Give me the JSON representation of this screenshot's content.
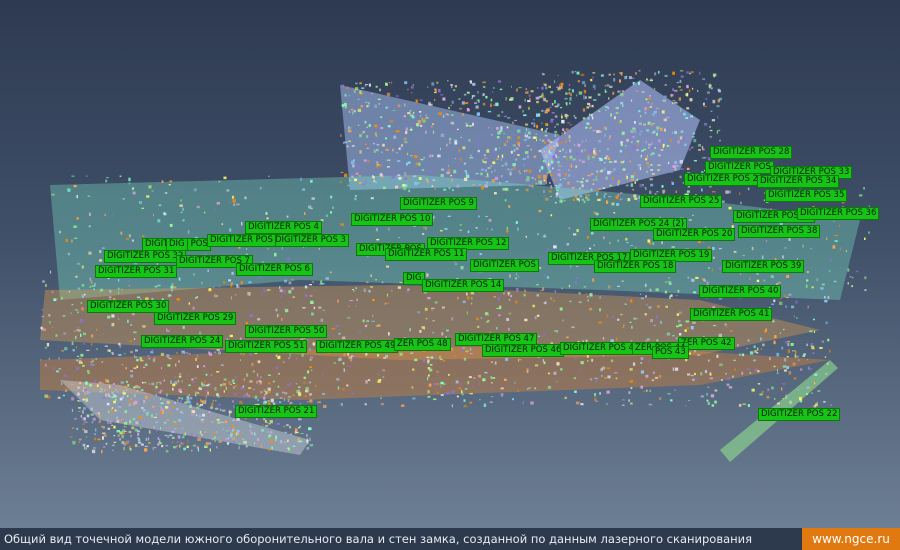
{
  "colors": {
    "marker_bg": "#16c416",
    "caption_bar": "#2d3a4e",
    "site_badge": "#e07a10",
    "cloud_palette": [
      "#7fffd4",
      "#98fb98",
      "#87cefa",
      "#dda0dd",
      "#b0c4de",
      "#e6e6fa",
      "#f5deb3",
      "#90ee90",
      "#ff8c00",
      "#ffa54f",
      "#9370db",
      "#ffff66"
    ]
  },
  "markers": [
    {
      "label": "DIGITIZER POS 28"
    },
    {
      "label": "DIGITIZER POS"
    },
    {
      "label": "DIGITIZER POS 33"
    },
    {
      "label": "DIGITIZER POS 2"
    },
    {
      "label": "DIGITIZER POS 34"
    },
    {
      "label": "DIGITIZER POS 35"
    },
    {
      "label": "DIGITIZER POS 9"
    },
    {
      "label": "DIGITIZER POS 25"
    },
    {
      "label": "DIGITIZER POS 37"
    },
    {
      "label": "DIGITIZER POS 36"
    },
    {
      "label": "DIGITIZER POS 10"
    },
    {
      "label": "DIGITIZER POS 24 (2)"
    },
    {
      "label": "DIGITIZER POS 4"
    },
    {
      "label": "DIGITIZER POS 38"
    },
    {
      "label": "DIGITIZER POS 20"
    },
    {
      "label": "DIGITIZER POS 3"
    },
    {
      "label": "DIGITIZER POS"
    },
    {
      "label": "DIGITIZER POS 12"
    },
    {
      "label": "DIG"
    },
    {
      "label": "DIGITIZER POS"
    },
    {
      "label": "DIGITIZER POS"
    },
    {
      "label": "DIGITIZER POS 32"
    },
    {
      "label": "DIGITIZER POS 11"
    },
    {
      "label": "DIGITIZER POS 19"
    },
    {
      "label": "DIGITIZER POS 7"
    },
    {
      "label": "DIGITIZER POS 17"
    },
    {
      "label": "DIGITIZER POS 18"
    },
    {
      "label": "DIGITIZER POS"
    },
    {
      "label": "DIGITIZER POS 39"
    },
    {
      "label": "DIGITIZER POS 31"
    },
    {
      "label": "DIGITIZER POS 6"
    },
    {
      "label": "DIG"
    },
    {
      "label": "DIGITIZER POS 14"
    },
    {
      "label": "DIGITIZER POS 40"
    },
    {
      "label": "DIGITIZER POS 30"
    },
    {
      "label": "DIGITIZER POS 41"
    },
    {
      "label": "DIGITIZER POS 29"
    },
    {
      "label": "DIGITIZER POS 50"
    },
    {
      "label": "DIGITIZER POS 47"
    },
    {
      "label": "DIGITIZER POS 24"
    },
    {
      "label": "ZER POS 42"
    },
    {
      "label": "DIGITIZER POS 51"
    },
    {
      "label": "DIGITIZER POS 49"
    },
    {
      "label": "ZER POS 48"
    },
    {
      "label": "DIGITIZER POS 46"
    },
    {
      "label": "DIGITIZER POS 45"
    },
    {
      "label": "ZER POS 44"
    },
    {
      "label": "POS 43"
    },
    {
      "label": "DIGITIZER POS 21"
    },
    {
      "label": "DIGITIZER POS 22"
    }
  ],
  "caption": {
    "text": "Общий вид точечной модели южного оборонительного вала и стен замка, созданной по данным лазерного сканирования",
    "site": "www.ngce.ru"
  }
}
